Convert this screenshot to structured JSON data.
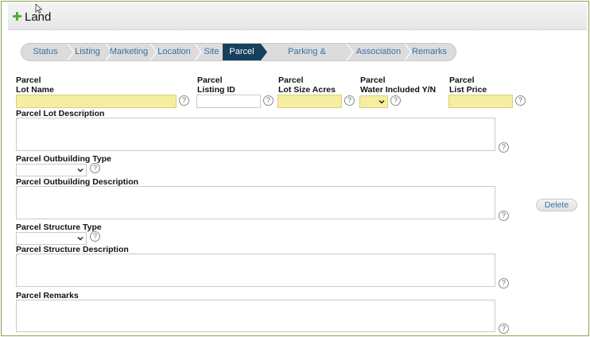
{
  "header": {
    "title": "Land",
    "icon": "plus-icon"
  },
  "tabs": [
    {
      "label": "Status"
    },
    {
      "label": "Listing"
    },
    {
      "label": "Marketing"
    },
    {
      "label": "Location"
    },
    {
      "label": "Site"
    },
    {
      "label": "Parcel",
      "active": true
    },
    {
      "label": "Parking & Structures"
    },
    {
      "label": "Association"
    },
    {
      "label": "Remarks"
    }
  ],
  "fields": {
    "lot_name": {
      "label1": "Parcel",
      "label2": "Lot Name",
      "value": ""
    },
    "listing_id": {
      "label1": "Parcel",
      "label2": "Listing ID",
      "value": ""
    },
    "lot_size": {
      "label1": "Parcel",
      "label2": "Lot Size Acres",
      "value": ""
    },
    "water": {
      "label1": "Parcel",
      "label2": "Water Included Y/N",
      "value": ""
    },
    "list_price": {
      "label1": "Parcel",
      "label2": "List Price",
      "value": ""
    },
    "lot_description": {
      "label": "Parcel Lot Description",
      "value": ""
    },
    "outbuilding_type": {
      "label": "Parcel Outbuilding Type",
      "value": ""
    },
    "outbuilding_description": {
      "label": "Parcel Outbuilding Description",
      "value": ""
    },
    "structure_type": {
      "label": "Parcel Structure Type",
      "value": ""
    },
    "structure_description": {
      "label": "Parcel Structure Description",
      "value": ""
    },
    "remarks": {
      "label": "Parcel Remarks",
      "value": ""
    }
  },
  "help_glyph": "?",
  "delete_label": "Delete",
  "colors": {
    "active_tab": "#16405e",
    "required_field": "#f6ee9f",
    "link": "#3a6fa5",
    "frame_border": "#8aa05a"
  }
}
